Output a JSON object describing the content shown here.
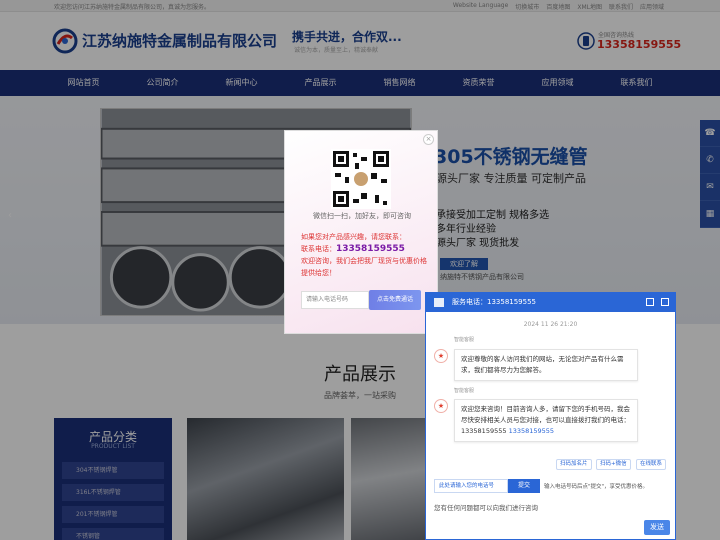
{
  "topbar": {
    "welcome": "欢迎您访问江苏纳施特金属制品有限公司，真诚为您服务。",
    "links": [
      "Website Language",
      "切换城市",
      "百度地图",
      "XML地图",
      "联系我们",
      "应用领域"
    ]
  },
  "header": {
    "company": "江苏纳施特金属制品有限公司",
    "slogan": "携手共进，合作双...",
    "slogan_sub": "诚信为本，质量至上，精诚奉献",
    "hotline_label": "全国咨询热线",
    "hotline": "13358159555"
  },
  "nav": [
    "网站首页",
    "公司简介",
    "新闻中心",
    "产品展示",
    "销售网络",
    "资质荣誉",
    "应用领域",
    "联系我们"
  ],
  "banner": {
    "title": "305不锈钢无缝管",
    "subtitle": "源头厂家 专注质量 可定制产品",
    "lines": [
      "承接受加工定制 规格多选",
      "多年行业经验",
      "源头厂家 现货批发"
    ],
    "button": "欢迎了解",
    "note": "纳施特不锈钢产品有限公司"
  },
  "side_tools": [
    "☎",
    "✆",
    "✉",
    "▦"
  ],
  "products": {
    "title": "产品展示",
    "subtitle": "品牌荟萃，一站采购",
    "category_title": "产品分类",
    "category_title_en": "PRODUCT LIST",
    "categories": [
      "304不锈钢焊管",
      "316L不锈钢焊管",
      "201不锈钢焊管",
      "不锈钢管"
    ]
  },
  "popup": {
    "qr_caption": "微信扫一扫，加好友，即可咨询",
    "line1": "如果您对产品感兴趣，请您联系：",
    "line2_label": "联系电话：",
    "line2_phone": "13358159555",
    "line3": "欢迎咨询，我们会把我厂现货与优惠价格提供给您！",
    "input_placeholder": "请输入电话号码",
    "submit": "点击免费通话",
    "close": "×"
  },
  "chat": {
    "header": "服务电话：13358159555",
    "timestamp": "2024 11 26 21:20",
    "agent_name": "智能客服",
    "msg1": "欢迎尊敬的客人访问我们的网站，无论您对产品有什么需求，我们都将尽力为您解答。",
    "msg2_text": "欢迎您来咨询！目前咨询人多，请留下您的手机号码，我会尽快安排相关人员与您对接，也可以直接拨打我们的电话：13358159555",
    "msg2_link": "13358159555",
    "chips": [
      "扫码加名片",
      "扫码+微信",
      "在线联系"
    ],
    "phone_placeholder": "此处请输入您的电话号",
    "phone_submit": "提交",
    "phone_hint": "输入电话号码后点\"提交\"，享受优惠价格。",
    "input_text": "您有任何问题都可以向我们进行咨询",
    "send": "发送"
  }
}
